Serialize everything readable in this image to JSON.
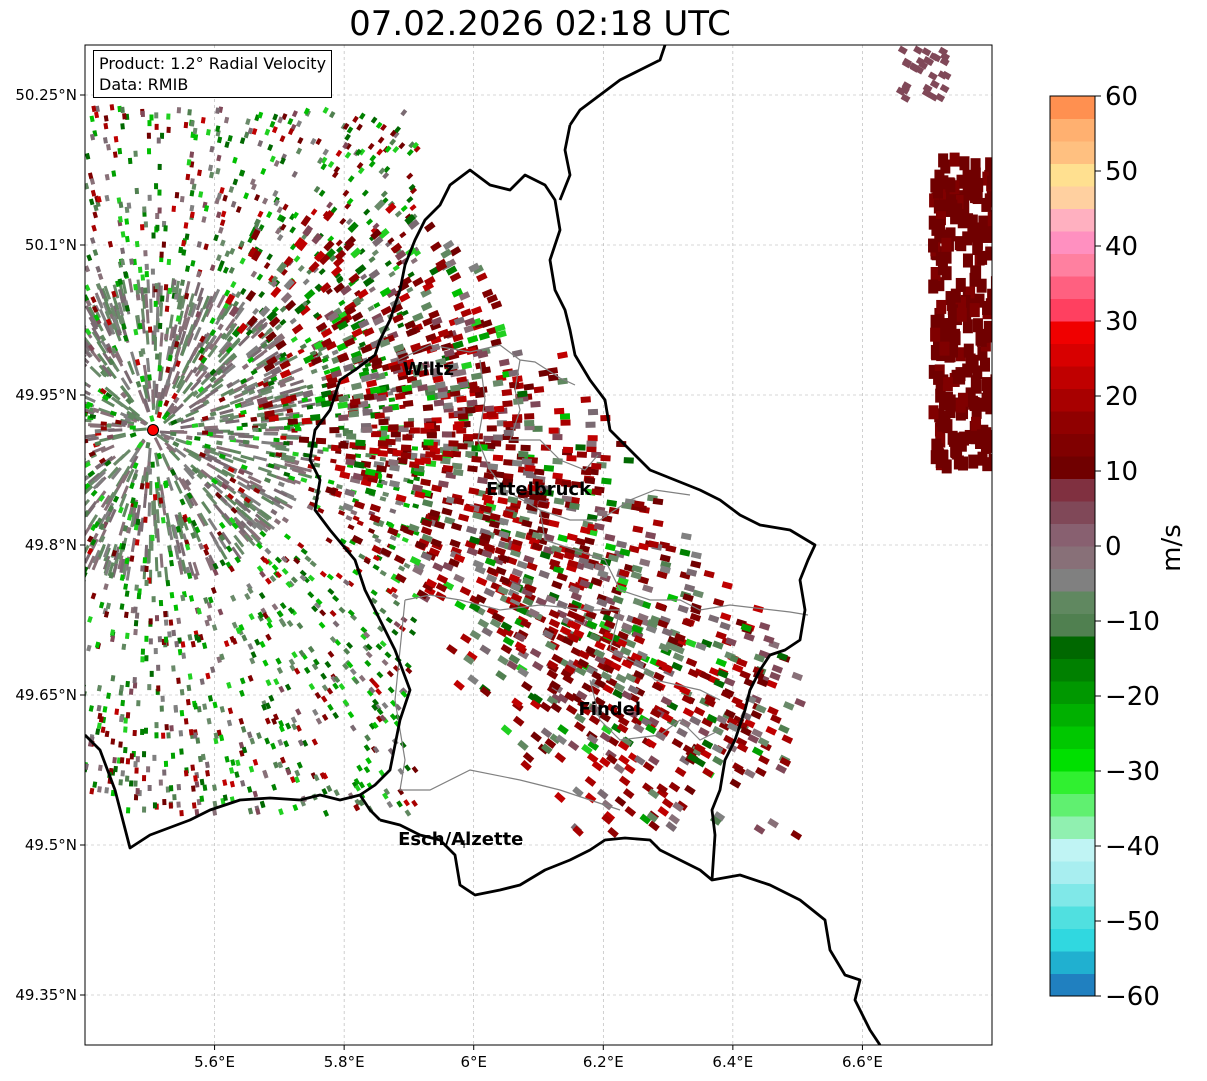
{
  "title": "07.02.2026 02:18 UTC",
  "info": {
    "product": "Product: 1.2° Radial Velocity",
    "data": "Data: RMIB"
  },
  "map": {
    "lon_range": [
      5.4,
      6.8
    ],
    "lat_range": [
      49.3,
      50.3
    ],
    "lon_ticks": [
      "5.6°E",
      "5.8°E",
      "6°E",
      "6.2°E",
      "6.4°E",
      "6.6°E"
    ],
    "lat_ticks": [
      "49.35°N",
      "49.5°N",
      "49.65°N",
      "49.8°N",
      "49.95°N",
      "50.1°N",
      "50.25°N"
    ],
    "grid": true,
    "radar_site": {
      "lon": 5.505,
      "lat": 49.915,
      "color": "#ff0000"
    },
    "cities": [
      {
        "name": "Wiltz",
        "lon": 5.93,
        "lat": 49.97
      },
      {
        "name": "Ettelbruck",
        "lon": 6.1,
        "lat": 49.85
      },
      {
        "name": "Findel",
        "lon": 6.21,
        "lat": 49.63
      },
      {
        "name": "Esch/Alzette",
        "lon": 5.98,
        "lat": 49.5
      }
    ]
  },
  "colorbar": {
    "label": "m/s",
    "min": -60,
    "max": 60,
    "ticks": [
      "60",
      "50",
      "40",
      "30",
      "20",
      "10",
      "0",
      "−10",
      "−20",
      "−30",
      "−40",
      "−50",
      "−60"
    ],
    "colors": [
      "#2080c0",
      "#20b0d0",
      "#30d8e0",
      "#50e0e0",
      "#80e8e8",
      "#a8eef0",
      "#c0f4f4",
      "#90f0b0",
      "#60f070",
      "#30f030",
      "#00e000",
      "#00c800",
      "#00b000",
      "#009800",
      "#008000",
      "#006800",
      "#508050",
      "#608860",
      "#808080",
      "#887078",
      "#886070",
      "#804858",
      "#803040",
      "#700000",
      "#800000",
      "#900000",
      "#a80000",
      "#c00000",
      "#d80000",
      "#f00000",
      "#ff4060",
      "#ff6080",
      "#ff80a0",
      "#ff90c0",
      "#ffb0c0",
      "#ffd0a0",
      "#ffe090",
      "#ffc080",
      "#ffb070",
      "#ff9050"
    ]
  }
}
